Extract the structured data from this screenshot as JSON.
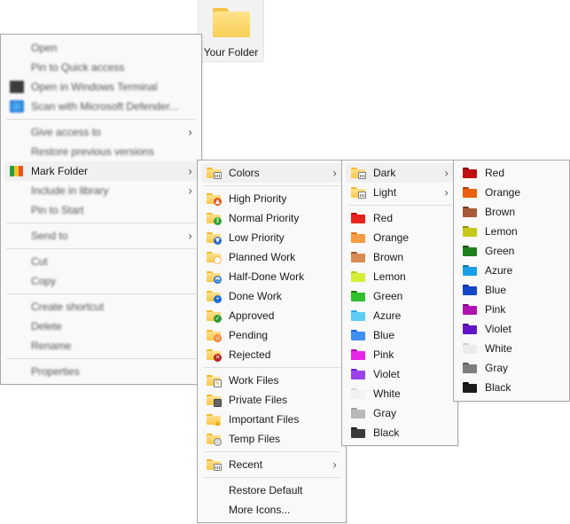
{
  "desktop": {
    "folder_label": "Your Folder"
  },
  "main_menu": {
    "items": [
      {
        "label": "Open",
        "blurred": true
      },
      {
        "label": "Pin to Quick access",
        "blurred": true
      },
      {
        "label": "Open in Windows Terminal",
        "blurred": true,
        "icon": "terminal-icon"
      },
      {
        "label": "Scan with Microsoft Defender...",
        "blurred": true,
        "icon": "defender-shield-icon"
      },
      {
        "label": "Give access to",
        "blurred": true,
        "submenu": true
      },
      {
        "label": "Restore previous versions",
        "blurred": true
      },
      {
        "label": "Mark Folder",
        "blurred": false,
        "submenu": true,
        "icon": "mark-folder-icon",
        "highlighted": true
      },
      {
        "label": "Include in library",
        "blurred": true,
        "submenu": true
      },
      {
        "label": "Pin to Start",
        "blurred": true
      },
      {
        "label": "Send to",
        "blurred": true,
        "submenu": true
      },
      {
        "label": "Cut",
        "blurred": true
      },
      {
        "label": "Copy",
        "blurred": true
      },
      {
        "label": "Create shortcut",
        "blurred": true
      },
      {
        "label": "Delete",
        "blurred": true
      },
      {
        "label": "Rename",
        "blurred": true
      },
      {
        "label": "Properties",
        "blurred": true
      }
    ]
  },
  "mark_menu": {
    "colors": {
      "label": "Colors",
      "icon": "folder-calendar-icon",
      "submenu": true
    },
    "priority_items": [
      {
        "label": "High Priority",
        "icon": "folder-arrow-up-icon",
        "badge_color": "#e8541c"
      },
      {
        "label": "Normal Priority",
        "icon": "folder-arrows-updown-icon",
        "badge_color": "#2fa62f"
      },
      {
        "label": "Low Priority",
        "icon": "folder-arrow-down-icon",
        "badge_color": "#2766c9"
      },
      {
        "label": "Planned Work",
        "icon": "folder-circle-empty-icon",
        "badge_color": "#f0b74a"
      },
      {
        "label": "Half-Done Work",
        "icon": "folder-circle-half-icon",
        "badge_color": "#2a78d4"
      },
      {
        "label": "Done Work",
        "icon": "folder-circle-full-icon",
        "badge_color": "#1f6fd6"
      },
      {
        "label": "Approved",
        "icon": "folder-check-icon",
        "badge_color": "#2c9a36"
      },
      {
        "label": "Pending",
        "icon": "folder-pending-icon",
        "badge_color": "#ef7a2a"
      },
      {
        "label": "Rejected",
        "icon": "folder-rejected-icon",
        "badge_color": "#b3221c"
      }
    ],
    "file_items": [
      {
        "label": "Work Files",
        "icon": "folder-document-icon"
      },
      {
        "label": "Private Files",
        "icon": "folder-lock-icon"
      },
      {
        "label": "Important Files",
        "icon": "folder-warning-icon"
      },
      {
        "label": "Temp Files",
        "icon": "folder-clock-icon"
      }
    ],
    "recent": {
      "label": "Recent",
      "icon": "folder-calendar-icon",
      "submenu": true
    },
    "restore_default": "Restore Default",
    "more_icons": "More Icons..."
  },
  "colors_menu": {
    "dark": {
      "label": "Dark",
      "submenu": true
    },
    "light": {
      "label": "Light",
      "submenu": true
    },
    "colors": [
      {
        "label": "Red",
        "color": "#e8231c",
        "tab": "#a8120e"
      },
      {
        "label": "Orange",
        "color": "#f59a45",
        "tab": "#e07020"
      },
      {
        "label": "Brown",
        "color": "#d88a55",
        "tab": "#9a5530"
      },
      {
        "label": "Lemon",
        "color": "#d6ee38",
        "tab": "#b6cc20"
      },
      {
        "label": "Green",
        "color": "#2fbf2f",
        "tab": "#1a7f1a"
      },
      {
        "label": "Azure",
        "color": "#5ccdf0",
        "tab": "#2fa8e0"
      },
      {
        "label": "Blue",
        "color": "#3f8ff0",
        "tab": "#1b63d0"
      },
      {
        "label": "Pink",
        "color": "#e626e6",
        "tab": "#a010a0"
      },
      {
        "label": "Violet",
        "color": "#9a42e8",
        "tab": "#6a1fc0"
      },
      {
        "label": "White",
        "color": "#f2f2f2",
        "tab": "#d8d8d8"
      },
      {
        "label": "Gray",
        "color": "#b8b8b8",
        "tab": "#9a9a9a"
      },
      {
        "label": "Black",
        "color": "#3a3a3a",
        "tab": "#1a1a1a"
      }
    ]
  },
  "dark_menu": {
    "colors": [
      {
        "label": "Red",
        "color": "#c01010",
        "tab": "#7a0808"
      },
      {
        "label": "Orange",
        "color": "#e8600e",
        "tab": "#a84008"
      },
      {
        "label": "Brown",
        "color": "#a8583a",
        "tab": "#6e3622"
      },
      {
        "label": "Lemon",
        "color": "#c4c81a",
        "tab": "#8e9010"
      },
      {
        "label": "Green",
        "color": "#1f7f1f",
        "tab": "#124d12"
      },
      {
        "label": "Azure",
        "color": "#1a9fe6",
        "tab": "#0e72b0"
      },
      {
        "label": "Blue",
        "color": "#1446c8",
        "tab": "#0a2c8a"
      },
      {
        "label": "Pink",
        "color": "#b012b0",
        "tab": "#760a76"
      },
      {
        "label": "Violet",
        "color": "#6216c8",
        "tab": "#400c8a"
      },
      {
        "label": "White",
        "color": "#ececec",
        "tab": "#cfcfcf"
      },
      {
        "label": "Gray",
        "color": "#7e7e7e",
        "tab": "#5a5a5a"
      },
      {
        "label": "Black",
        "color": "#1c1c1c",
        "tab": "#0a0a0a"
      }
    ]
  }
}
